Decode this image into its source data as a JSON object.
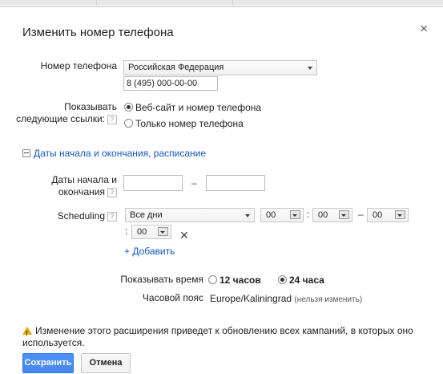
{
  "dialog": {
    "title": "Изменить номер телефона",
    "close_glyph": "×"
  },
  "phone": {
    "label": "Номер телефона",
    "country": "Российская Федерация",
    "number": "8 (495) 000-00-00"
  },
  "links": {
    "label": "Показывать следующие ссылки:",
    "help": "?",
    "options": [
      {
        "label": "Веб-сайт и номер телефона",
        "selected": true
      },
      {
        "label": "Только номер телефона",
        "selected": false
      }
    ]
  },
  "schedule_section": {
    "label": "Даты начала и окончания, расписание"
  },
  "dates": {
    "label": "Даты начала и окончания",
    "help": "?",
    "start": "",
    "end": "",
    "separator": "–"
  },
  "scheduling": {
    "label": "Scheduling",
    "help": "?",
    "days": "Все дни",
    "start_hour": "00",
    "start_minute": "00",
    "end_hour": "00",
    "end_minute": "00",
    "separator": "–",
    "colon": ":",
    "remove_glyph": "✕",
    "add_label": "+ Добавить"
  },
  "time_format": {
    "label": "Показывать время",
    "options": [
      {
        "label": "12 часов",
        "selected": false
      },
      {
        "label": "24 часа",
        "selected": true
      }
    ]
  },
  "timezone": {
    "label": "Часовой пояс",
    "value": "Europe/Kaliningrad",
    "note": "(нельзя изменить)"
  },
  "warning": {
    "text": "Изменение этого расширения приведет к обновлению всех кампаний, в которых оно используется."
  },
  "buttons": {
    "save": "Сохранить",
    "cancel": "Отмена"
  },
  "colors": {
    "link": "#1155cc",
    "primary": "#4d90fe",
    "warning": "#e8a800"
  }
}
